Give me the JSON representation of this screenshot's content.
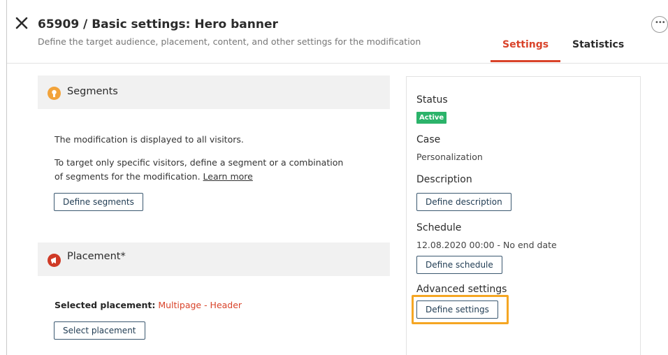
{
  "header": {
    "title": "65909 / Basic settings: Hero banner",
    "subtitle": "Define the target audience, placement, content, and other settings for the modification",
    "more_label": "•••"
  },
  "tabs": [
    {
      "label": "Settings",
      "active": true
    },
    {
      "label": "Statistics",
      "active": false
    }
  ],
  "segments": {
    "title": "Segments",
    "line1": "The modification is displayed to all visitors.",
    "line2": "To target only specific visitors, define a segment or a combination",
    "line3": "of segments for the modification.",
    "learn_more": "Learn more",
    "button": "Define segments"
  },
  "placement": {
    "title": "Placement*",
    "selected_label": "Selected placement:",
    "selected_value": "Multipage - Header",
    "button": "Select placement"
  },
  "side": {
    "status_label": "Status",
    "status_badge": "Active",
    "case_label": "Case",
    "case_value": "Personalization",
    "description_label": "Description",
    "description_button": "Define description",
    "schedule_label": "Schedule",
    "schedule_value": "12.08.2020 00:00 - No end date",
    "schedule_button": "Define schedule",
    "advanced_label": "Advanced settings",
    "advanced_button": "Define settings"
  },
  "colors": {
    "accent": "#d9432a",
    "active_badge": "#2bb36a",
    "highlight": "#f5a623",
    "segments_icon": "#f2a33a",
    "placement_icon": "#cf3a26"
  }
}
